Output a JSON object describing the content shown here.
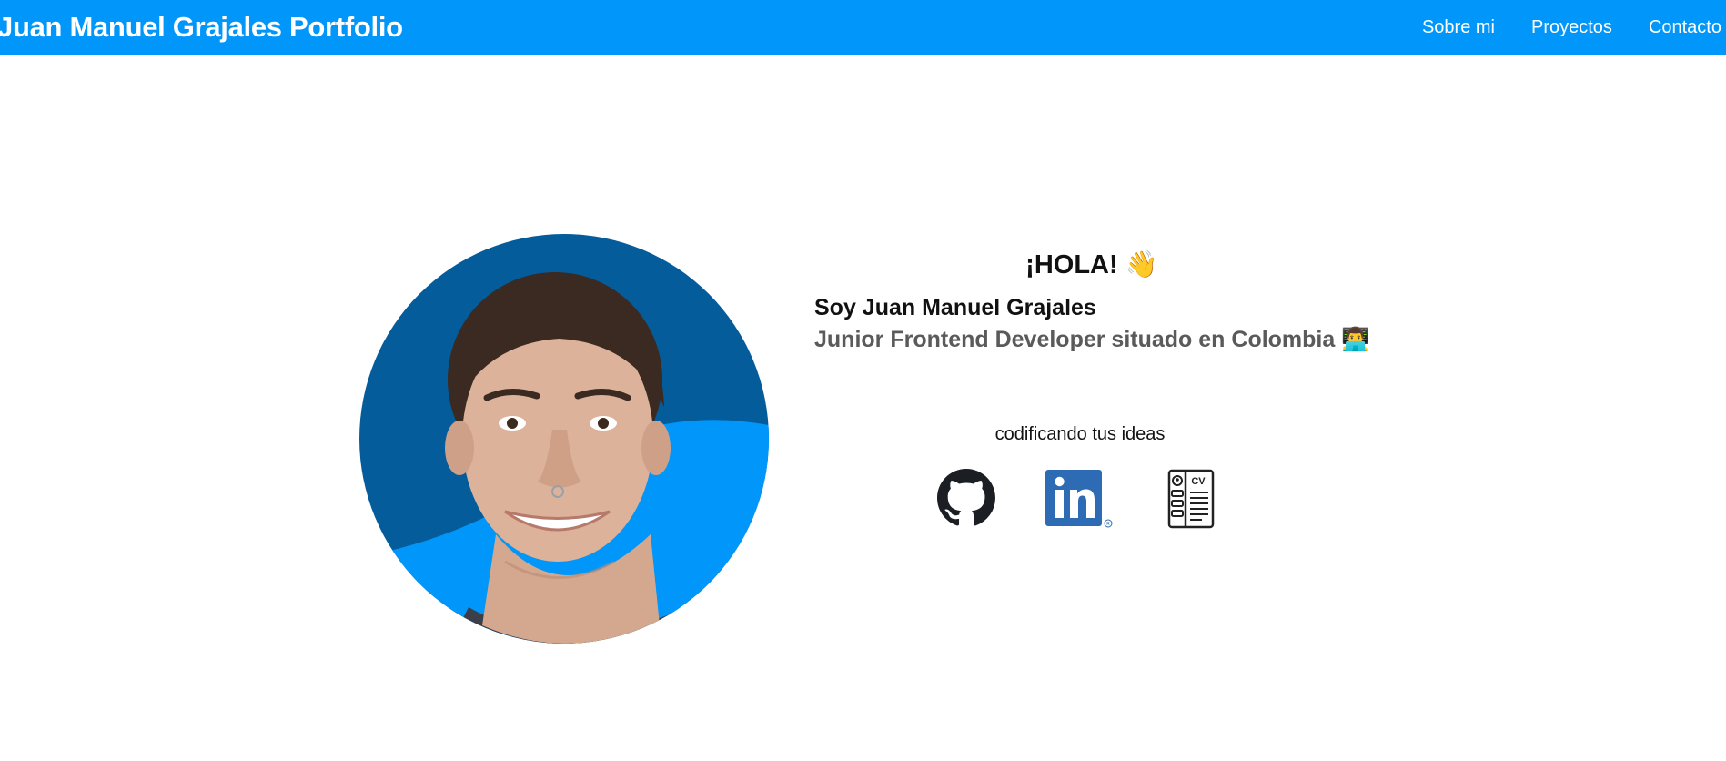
{
  "header": {
    "brand": "Juan Manuel Grajales Portfolio",
    "nav": [
      {
        "label": "Sobre mi"
      },
      {
        "label": "Proyectos"
      },
      {
        "label": "Contacto"
      }
    ]
  },
  "hero": {
    "greeting": "¡HOLA! 👋",
    "name_line": "Soy Juan Manuel Grajales",
    "role_line": "Junior Frontend Developer situado en Colombia 👨‍💻",
    "tagline": "codificando tus ideas",
    "social_links": [
      {
        "icon": "github-icon"
      },
      {
        "icon": "linkedin-icon"
      },
      {
        "icon": "cv-icon"
      }
    ]
  },
  "colors": {
    "header_bg": "#0096fa",
    "avatar_bg_dark": "#055c9b",
    "avatar_bg_light": "#0096fa",
    "role_text": "#5a5a5a"
  }
}
